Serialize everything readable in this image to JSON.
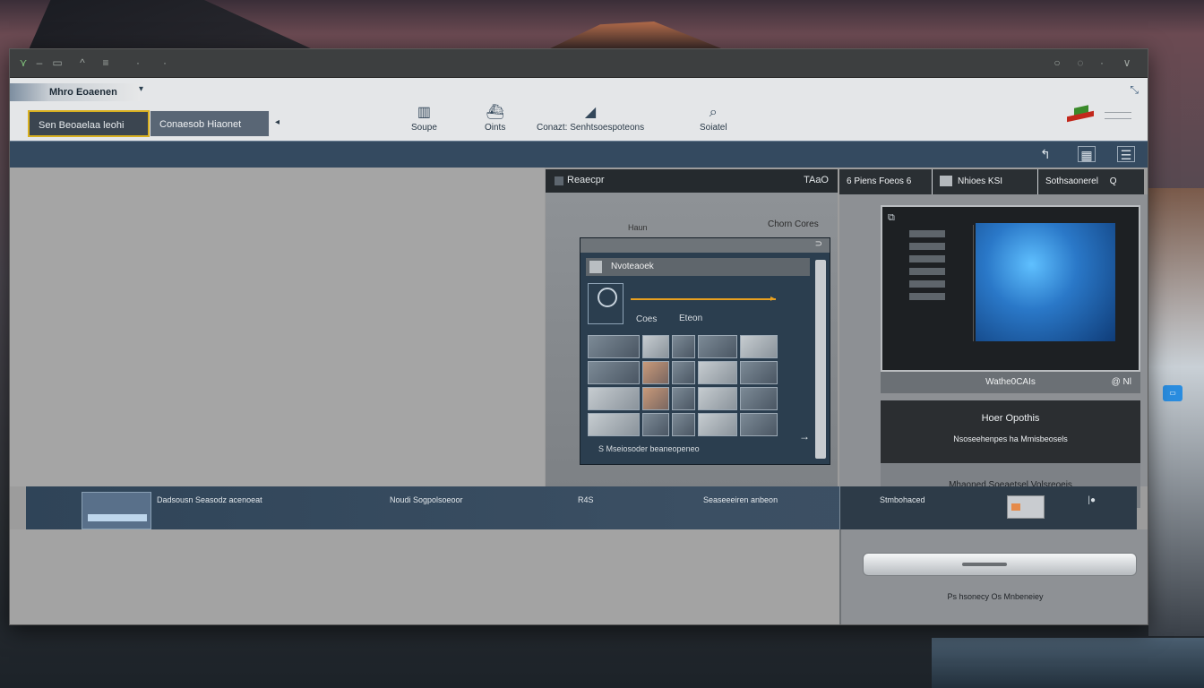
{
  "window": {
    "app_title": "Mhro Eoaenen",
    "tabs": [
      {
        "label": "Sen Beoaelaa leohi"
      },
      {
        "label": "Conaesob Hiaonet"
      }
    ],
    "tools": [
      {
        "label": "Soupe",
        "icon": "layout-icon"
      },
      {
        "label": "Oints",
        "icon": "ship-icon"
      },
      {
        "label": "Conazt: Senhtsoespoteons",
        "icon": "triangle-icon"
      },
      {
        "label": "Soiatel",
        "icon": "search-icon"
      }
    ]
  },
  "center_panel": {
    "header_left": "Reaecpr",
    "header_right": "TAaO",
    "fold_sub": "Haun",
    "fold_right": "Chorn Cores",
    "card_title": "Nvoteaoek",
    "card_caption": "Coes",
    "card_caption2": "Eteon",
    "card_footer": "S Mseiosoder beaneopeneo"
  },
  "right_panel": {
    "tabs": [
      {
        "label": "6 Piens Foeos 6"
      },
      {
        "label": "Nhioes KSI"
      },
      {
        "label": "Sothsaonerel"
      }
    ],
    "tab_suffix": "Q",
    "preview_caption": "Wathe0CAIs",
    "preview_caption_right": "@ Nl",
    "info_title": "Hoer Opothis",
    "info_subtitle": "Nsoseehenpes ha Mmisbeosels",
    "info_footer": "Mhaoned Soeaetsel Volsreoeis"
  },
  "bottom_strip": {
    "item1": "Dadsousn Seasodz acenoeat",
    "item2": "Noudi Sogpolsoeoor",
    "item3": "R4S",
    "item4": "Seaseeeiren anbeon",
    "item5": "Stmbohaced"
  },
  "lower_right": {
    "footer": "Ps hsonecy Os Mnbeneiey"
  }
}
